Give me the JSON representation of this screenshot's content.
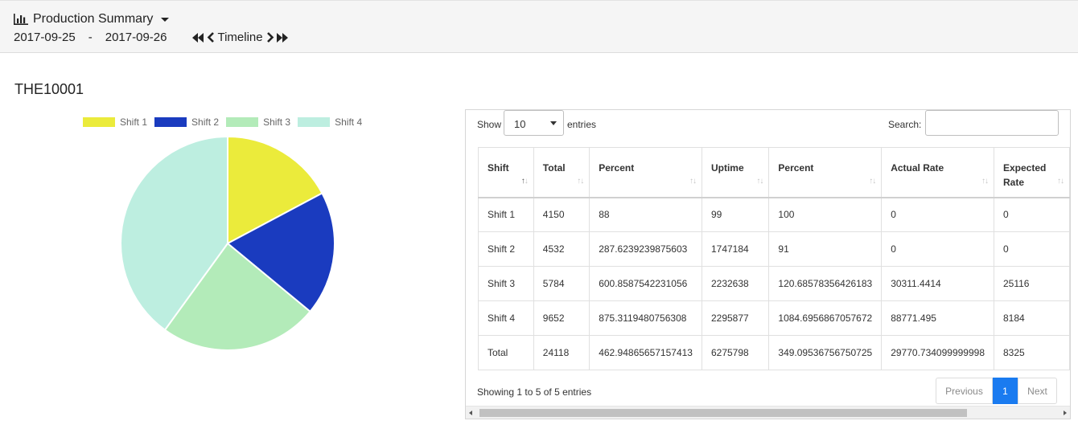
{
  "header": {
    "title": "Production Summary",
    "date_start": "2017-09-25",
    "date_sep": "-",
    "date_end": "2017-09-26",
    "timeline_label": "Timeline"
  },
  "section_title": "THE10001",
  "colors": {
    "shift1": "#ebeb3b",
    "shift2": "#1a3bbf",
    "shift3": "#b3ebb9",
    "shift4": "#bdeee0",
    "accent": "#1a7bf0"
  },
  "chart_data": {
    "type": "pie",
    "legend_position": "top",
    "series": [
      {
        "name": "Shift 1",
        "value": 4150,
        "color": "#ebeb3b"
      },
      {
        "name": "Shift 2",
        "value": 4532,
        "color": "#1a3bbf"
      },
      {
        "name": "Shift 3",
        "value": 5784,
        "color": "#b3ebb9"
      },
      {
        "name": "Shift 4",
        "value": 9652,
        "color": "#bdeee0"
      }
    ]
  },
  "table_controls": {
    "show_label": "Show",
    "length_value": "10",
    "entries_label": "entries",
    "search_label": "Search:",
    "search_value": ""
  },
  "table": {
    "columns": [
      "Shift",
      "Total",
      "Percent",
      "Uptime",
      "Percent",
      "Actual Rate",
      "Expected Rate"
    ],
    "rows": [
      [
        "Shift 1",
        "4150",
        "88",
        "99",
        "100",
        "0",
        "0"
      ],
      [
        "Shift 2",
        "4532",
        "287.6239239875603",
        "1747184",
        "91",
        "0",
        "0"
      ],
      [
        "Shift 3",
        "5784",
        "600.8587542231056",
        "2232638",
        "120.68578356426183",
        "30311.4414",
        "25116"
      ],
      [
        "Shift 4",
        "9652",
        "875.3119480756308",
        "2295877",
        "1084.6956867057672",
        "88771.495",
        "8184"
      ],
      [
        "Total",
        "24118",
        "462.94865657157413",
        "6275798",
        "349.09536756750725",
        "29770.734099999998",
        "8325"
      ]
    ]
  },
  "footer": {
    "info": "Showing 1 to 5 of 5 entries",
    "prev_label": "Previous",
    "current_page": "1",
    "next_label": "Next"
  }
}
